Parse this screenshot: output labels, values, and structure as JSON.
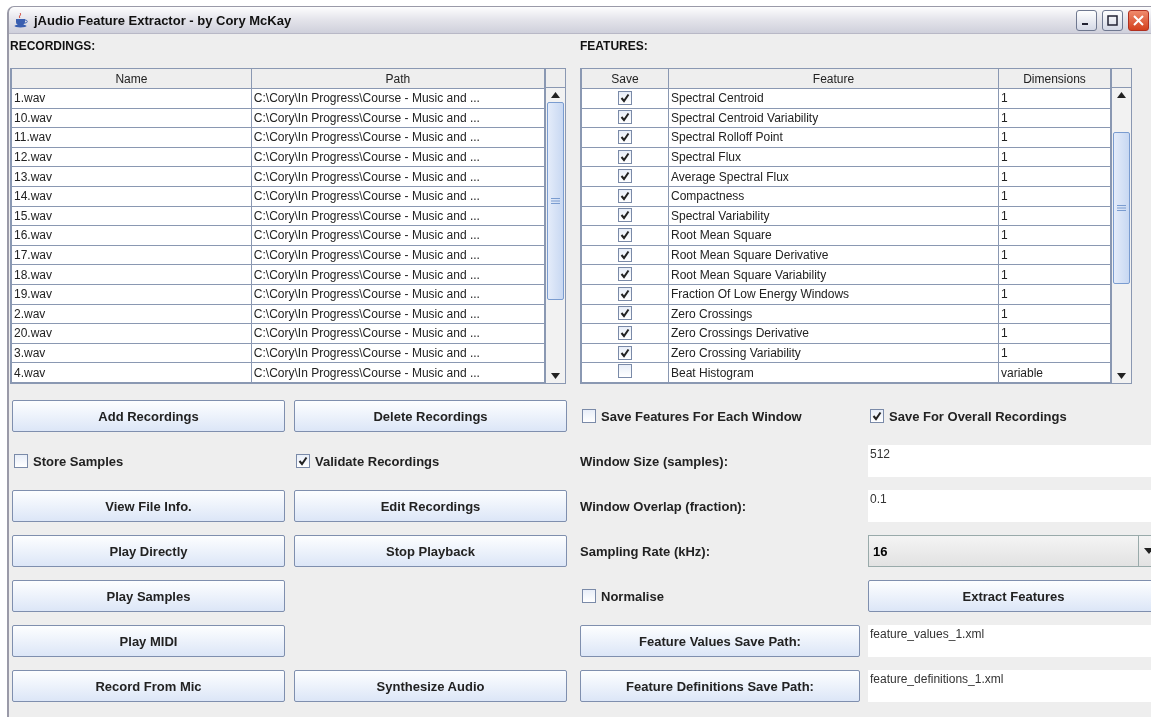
{
  "window": {
    "title": "jAudio Feature Extractor - by Cory McKay"
  },
  "recordings": {
    "label": "RECORDINGS:",
    "columns": [
      "Name",
      "Path"
    ],
    "rows": [
      {
        "name": "1.wav",
        "path": "C:\\Cory\\In Progress\\Course - Music and ..."
      },
      {
        "name": "10.wav",
        "path": "C:\\Cory\\In Progress\\Course - Music and ..."
      },
      {
        "name": "11.wav",
        "path": "C:\\Cory\\In Progress\\Course - Music and ..."
      },
      {
        "name": "12.wav",
        "path": "C:\\Cory\\In Progress\\Course - Music and ..."
      },
      {
        "name": "13.wav",
        "path": "C:\\Cory\\In Progress\\Course - Music and ..."
      },
      {
        "name": "14.wav",
        "path": "C:\\Cory\\In Progress\\Course - Music and ..."
      },
      {
        "name": "15.wav",
        "path": "C:\\Cory\\In Progress\\Course - Music and ..."
      },
      {
        "name": "16.wav",
        "path": "C:\\Cory\\In Progress\\Course - Music and ..."
      },
      {
        "name": "17.wav",
        "path": "C:\\Cory\\In Progress\\Course - Music and ..."
      },
      {
        "name": "18.wav",
        "path": "C:\\Cory\\In Progress\\Course - Music and ..."
      },
      {
        "name": "19.wav",
        "path": "C:\\Cory\\In Progress\\Course - Music and ..."
      },
      {
        "name": "2.wav",
        "path": "C:\\Cory\\In Progress\\Course - Music and ..."
      },
      {
        "name": "20.wav",
        "path": "C:\\Cory\\In Progress\\Course - Music and ..."
      },
      {
        "name": "3.wav",
        "path": "C:\\Cory\\In Progress\\Course - Music and ..."
      },
      {
        "name": "4.wav",
        "path": "C:\\Cory\\In Progress\\Course - Music and ..."
      }
    ]
  },
  "features": {
    "label": "FEATURES:",
    "columns": [
      "Save",
      "Feature",
      "Dimensions"
    ],
    "rows": [
      {
        "checked": true,
        "feature": "Spectral Centroid",
        "dimensions": "1"
      },
      {
        "checked": true,
        "feature": "Spectral Centroid Variability",
        "dimensions": "1"
      },
      {
        "checked": true,
        "feature": "Spectral Rolloff Point",
        "dimensions": "1"
      },
      {
        "checked": true,
        "feature": "Spectral Flux",
        "dimensions": "1"
      },
      {
        "checked": true,
        "feature": "Average Spectral Flux",
        "dimensions": "1"
      },
      {
        "checked": true,
        "feature": "Compactness",
        "dimensions": "1"
      },
      {
        "checked": true,
        "feature": "Spectral Variability",
        "dimensions": "1"
      },
      {
        "checked": true,
        "feature": "Root Mean Square",
        "dimensions": "1"
      },
      {
        "checked": true,
        "feature": "Root Mean Square Derivative",
        "dimensions": "1"
      },
      {
        "checked": true,
        "feature": "Root Mean Square Variability",
        "dimensions": "1"
      },
      {
        "checked": true,
        "feature": "Fraction Of Low Energy Windows",
        "dimensions": "1"
      },
      {
        "checked": true,
        "feature": "Zero Crossings",
        "dimensions": "1"
      },
      {
        "checked": true,
        "feature": "Zero Crossings Derivative",
        "dimensions": "1"
      },
      {
        "checked": true,
        "feature": "Zero Crossing Variability",
        "dimensions": "1"
      },
      {
        "checked": false,
        "feature": "Beat Histogram",
        "dimensions": "variable"
      }
    ]
  },
  "left_controls": [
    [
      {
        "kind": "button",
        "label": "Add Recordings"
      },
      {
        "kind": "button",
        "label": "Delete Recordings"
      }
    ],
    [
      {
        "kind": "checkbox",
        "label": "Store Samples",
        "checked": false
      },
      {
        "kind": "checkbox",
        "label": "Validate Recordings",
        "checked": true
      }
    ],
    [
      {
        "kind": "button",
        "label": "View File Info."
      },
      {
        "kind": "button",
        "label": "Edit Recordings"
      }
    ],
    [
      {
        "kind": "button",
        "label": "Play Directly"
      },
      {
        "kind": "button",
        "label": "Stop Playback"
      }
    ],
    [
      {
        "kind": "button",
        "label": "Play Samples"
      }
    ],
    [
      {
        "kind": "button",
        "label": "Play MIDI"
      }
    ],
    [
      {
        "kind": "button",
        "label": "Record From Mic"
      },
      {
        "kind": "button",
        "label": "Synthesize Audio"
      }
    ]
  ],
  "right_controls": [
    [
      {
        "kind": "checkbox",
        "label": "Save Features For Each Window",
        "checked": false
      },
      {
        "kind": "checkbox",
        "label": "Save For Overall Recordings",
        "checked": true
      }
    ],
    [
      {
        "kind": "label",
        "label": "Window Size (samples):"
      },
      {
        "kind": "field",
        "value": "512"
      }
    ],
    [
      {
        "kind": "label",
        "label": "Window Overlap (fraction):"
      },
      {
        "kind": "field",
        "value": "0.1"
      }
    ],
    [
      {
        "kind": "label",
        "label": "Sampling Rate (kHz):"
      },
      {
        "kind": "select",
        "value": "16"
      }
    ],
    [
      {
        "kind": "checkbox",
        "label": "Normalise",
        "checked": false
      },
      {
        "kind": "button",
        "label": "Extract Features"
      }
    ],
    [
      {
        "kind": "button",
        "label": "Feature Values Save Path:"
      },
      {
        "kind": "field",
        "value": "feature_values_1.xml"
      }
    ],
    [
      {
        "kind": "button",
        "label": "Feature Definitions Save Path:"
      },
      {
        "kind": "field",
        "value": "feature_definitions_1.xml"
      }
    ]
  ]
}
